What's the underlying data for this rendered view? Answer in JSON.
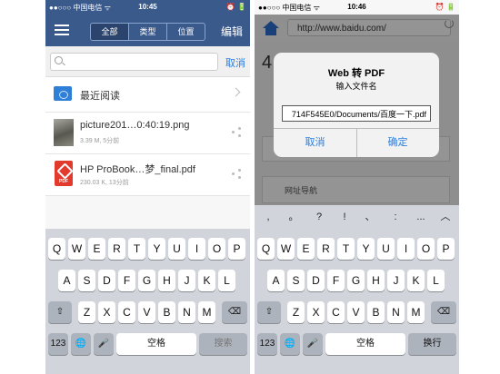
{
  "left": {
    "status": {
      "carrier": "●●○○○ 中国电信 ᯤ",
      "time": "10:45",
      "right": "⏰ 🔋"
    },
    "nav": {
      "tabs": [
        "全部",
        "类型",
        "位置"
      ],
      "active_tab": "全部",
      "edit": "编辑"
    },
    "search": {
      "placeholder": "",
      "cancel": "取消"
    },
    "recent": {
      "label": "最近阅读"
    },
    "files": [
      {
        "name": "picture201…0:40:19.png",
        "meta": "3.39 M, 5分前"
      },
      {
        "name": "HP ProBook…梦_final.pdf",
        "meta": "230.03 K, 13分前"
      }
    ],
    "pdf_icon_label": "PDF"
  },
  "right": {
    "status": {
      "carrier": "●●○○○ 中国电信 ᯤ",
      "time": "10:46",
      "right": "⏰ 🔋"
    },
    "url": "http://www.baidu.com/",
    "page_big_text": "4",
    "nav_card": "网址导航",
    "dialog": {
      "title": "Web 转 PDF",
      "subtitle": "输入文件名",
      "input_value": "714F545E0/Documents/百度一下.pdf",
      "cancel": "取消",
      "ok": "确定"
    },
    "punct": [
      ",",
      "。",
      "?",
      "!",
      "、",
      ":",
      "..."
    ]
  },
  "keyboard": {
    "row1": [
      "Q",
      "W",
      "E",
      "R",
      "T",
      "Y",
      "U",
      "I",
      "O",
      "P"
    ],
    "row2": [
      "A",
      "S",
      "D",
      "F",
      "G",
      "H",
      "J",
      "K",
      "L"
    ],
    "row3": [
      "Z",
      "X",
      "C",
      "V",
      "B",
      "N",
      "M"
    ],
    "key_123": "123",
    "globe": "🌐",
    "space": "空格",
    "left_action": "搜索",
    "right_action": "换行"
  }
}
